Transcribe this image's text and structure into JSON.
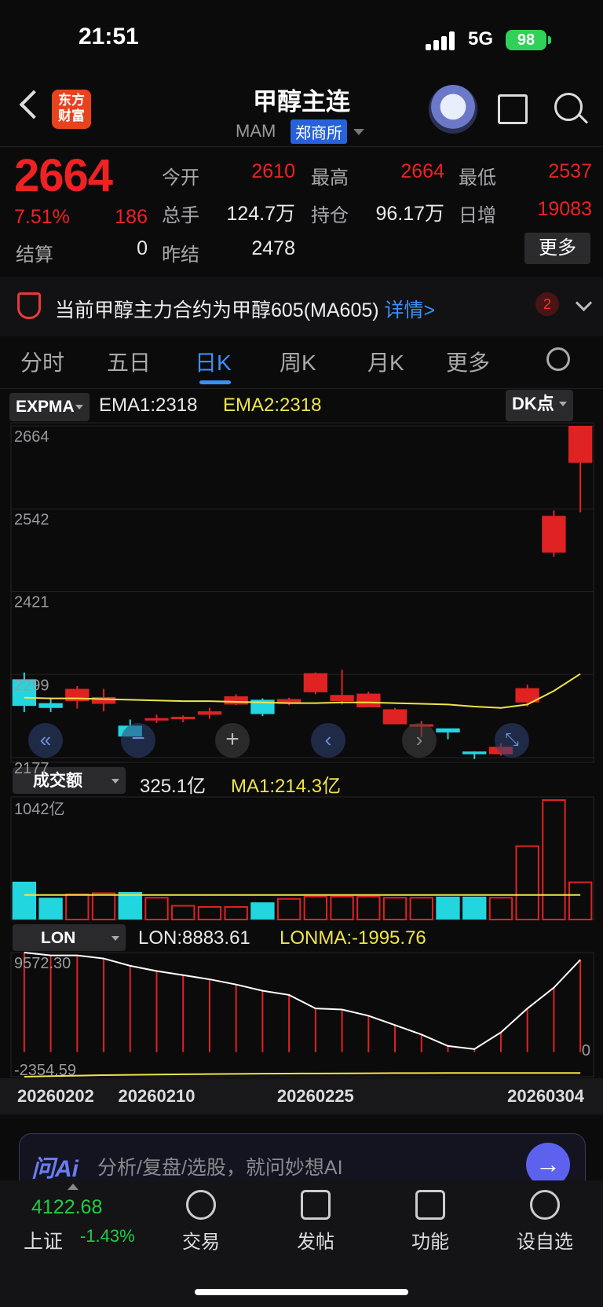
{
  "status_bar": {
    "time": "21:51",
    "network": "5G",
    "battery": "98"
  },
  "header": {
    "logo_text": "东方财富",
    "title": "甲醇主连",
    "code": "MAM",
    "exchange": "郑商所"
  },
  "quote": {
    "price": "2664",
    "change_pct": "7.51%",
    "change": "186",
    "stats": [
      {
        "label": "今开",
        "value": "2610"
      },
      {
        "label": "最高",
        "value": "2664"
      },
      {
        "label": "最低",
        "value": "2537"
      },
      {
        "label": "总手",
        "value": "124.7万"
      },
      {
        "label": "持仓",
        "value": "96.17万"
      },
      {
        "label": "日增",
        "value": "19083"
      },
      {
        "label": "结算",
        "value": "0"
      },
      {
        "label": "昨结",
        "value": "2478"
      }
    ],
    "more_label": "更多"
  },
  "notice": {
    "text": "当前甲醇主力合约为甲醇605(MA605)",
    "link": "详情>",
    "badge": "2"
  },
  "tabs": [
    {
      "label": "分时"
    },
    {
      "label": "五日"
    },
    {
      "label": "日K"
    },
    {
      "label": "周K"
    },
    {
      "label": "月K"
    },
    {
      "label": "更多"
    }
  ],
  "indicators": {
    "main": {
      "name": "EXPMA",
      "ema1": "EMA1:2318",
      "ema2": "EMA2:2318",
      "dk": "DK点"
    },
    "volume": {
      "name": "成交额",
      "value": "325.1亿",
      "ma1": "MA1:214.3亿"
    },
    "lon": {
      "name": "LON",
      "value": "LON:8883.61",
      "lonma": "LONMA:-1995.76"
    }
  },
  "chart_data": [
    {
      "type": "candlestick",
      "title": "",
      "y_ticks": [
        "2664",
        "2542",
        "2421",
        "2299",
        "2177"
      ],
      "ylim": [
        2177,
        2664
      ],
      "series": [
        {
          "open": [
            2292,
            2257,
            2260,
            2256,
            2224,
            2235,
            2236,
            2240,
            2255,
            2262,
            2256,
            2273,
            2260,
            2251,
            2226,
            2226,
            2220,
            2186,
            2182,
            2258,
            2478,
            2610
          ],
          "close": [
            2253,
            2250,
            2278,
            2266,
            2208,
            2235,
            2237,
            2245,
            2267,
            2241,
            2263,
            2301,
            2269,
            2271,
            2248,
            2226,
            2214,
            2182,
            2193,
            2279,
            2532,
            2664
          ],
          "high": [
            2302,
            2264,
            2282,
            2278,
            2233,
            2240,
            2239,
            2250,
            2270,
            2264,
            2265,
            2302,
            2306,
            2274,
            2250,
            2231,
            2219,
            2186,
            2198,
            2284,
            2540,
            2664
          ],
          "low": [
            2244,
            2244,
            2249,
            2245,
            2208,
            2228,
            2229,
            2234,
            2254,
            2238,
            2254,
            2270,
            2255,
            2262,
            2226,
            2207,
            2204,
            2175,
            2180,
            2252,
            2472,
            2537
          ]
        },
        {
          "name": "EMA",
          "values": [
            2265,
            2264,
            2264,
            2263,
            2262,
            2261,
            2260,
            2260,
            2259,
            2258,
            2257,
            2257,
            2258,
            2258,
            2257,
            2256,
            2255,
            2252,
            2250,
            2255,
            2275,
            2300
          ]
        }
      ]
    },
    {
      "type": "bar",
      "title": "成交额",
      "y_ticks": [
        "1042亿"
      ],
      "values": [
        330,
        190,
        220,
        230,
        240,
        190,
        120,
        110,
        110,
        150,
        180,
        200,
        200,
        200,
        190,
        190,
        200,
        200,
        190,
        640,
        1042,
        325
      ],
      "ma": [
        214,
        214,
        214,
        214,
        214,
        214,
        214,
        214,
        214,
        214,
        214,
        214,
        214,
        214,
        214,
        214,
        214,
        214,
        214,
        214,
        214,
        214
      ]
    },
    {
      "type": "line",
      "title": "LON",
      "y_ticks": [
        "9572.30",
        "0",
        "-2354.59"
      ],
      "x_ticks": [
        "20260202",
        "20260210",
        "20260225",
        "20260304"
      ],
      "values": [
        9572,
        9300,
        9300,
        9000,
        8300,
        7800,
        7400,
        7000,
        6500,
        5900,
        5500,
        4200,
        4100,
        3500,
        2600,
        1700,
        600,
        300,
        1900,
        4200,
        6200,
        8883
      ],
      "lonma": [
        -2354,
        -2300,
        -2250,
        -2200,
        -2180,
        -2150,
        -2120,
        -2100,
        -2080,
        -2060,
        -2050,
        -2040,
        -2030,
        -2020,
        -2010,
        -2005,
        -2000,
        -2000,
        -1998,
        -1997,
        -1996,
        -1995.76
      ]
    }
  ],
  "ai_bar": {
    "logo": "问Ai",
    "placeholder": "分析/复盘/选股，就问妙想AI"
  },
  "bottom_nav": {
    "index_value": "4122.68",
    "index_name": "上证",
    "index_pct": "-1.43%",
    "items": [
      {
        "label": "交易"
      },
      {
        "label": "发帖"
      },
      {
        "label": "功能"
      },
      {
        "label": "设自选"
      }
    ]
  }
}
